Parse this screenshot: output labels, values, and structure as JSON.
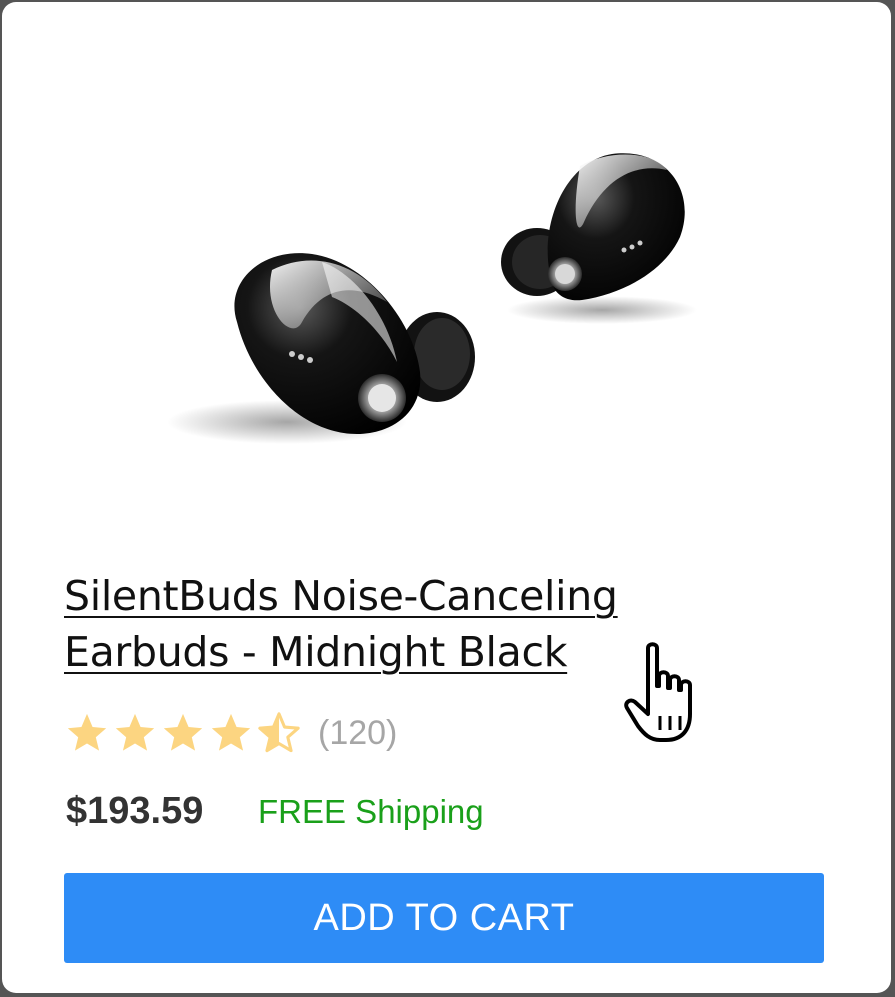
{
  "product": {
    "title_line1": "SilentBuds Noise-Canceling",
    "title_line2": "Earbuds - Midnight Black",
    "image_icon": "earbuds-product-image",
    "rating": 4.5,
    "rating_max": 5,
    "review_count": "(120)",
    "price": "$193.59",
    "shipping": "FREE Shipping",
    "add_to_cart_label": "ADD TO CART"
  },
  "colors": {
    "star": "#fcd581",
    "shipping": "#1aa01a",
    "button": "#2e8cf6",
    "review_count": "#a6a6a6"
  },
  "pointer": {
    "icon": "hand-pointer-icon"
  }
}
